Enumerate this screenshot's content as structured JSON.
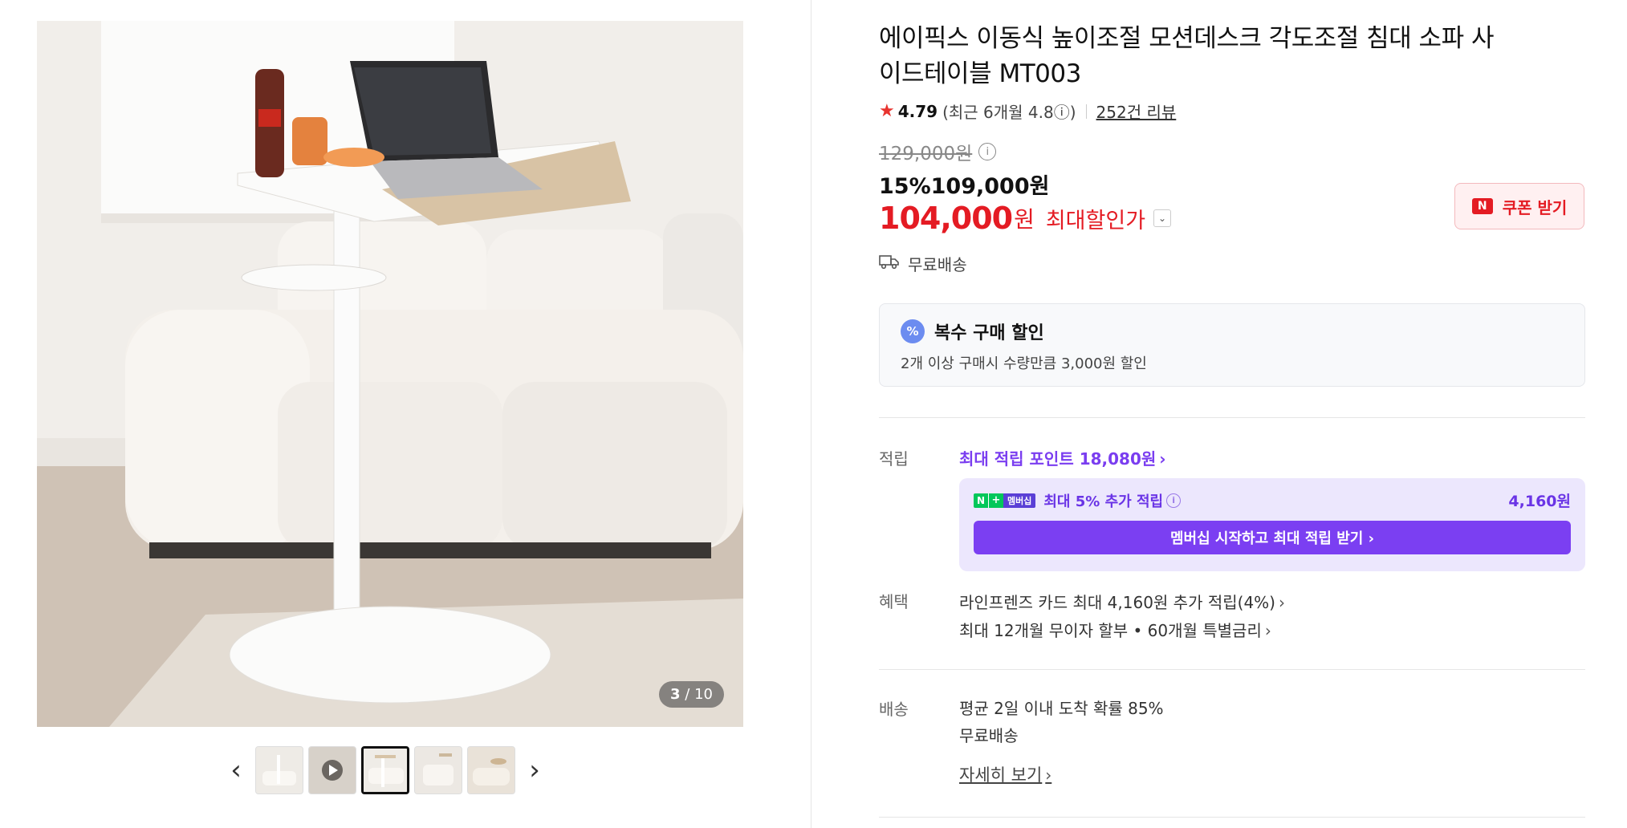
{
  "gallery": {
    "counter_current": "3",
    "counter_total": "/ 10",
    "prev_label": "‹",
    "next_label": "›"
  },
  "product": {
    "title": "에이픽스 이동식 높이조절 모션데스크 각도조절 침대 소파 사이드테이블 MT003",
    "rating": "4.79",
    "rating_recent": "(최근 6개월 4.8ⓘ)",
    "review_count": "252건 리뷰",
    "original_price": "129,000원",
    "sale_percent": "15%",
    "sale_price": "109,000원",
    "max_price": "104,000",
    "max_unit": "원",
    "max_label": "최대할인가",
    "coupon_label": "쿠폰 받기",
    "coupon_badge": "N",
    "shipping_free": "무료배송"
  },
  "multi_discount": {
    "title": "복수 구매 할인",
    "icon_text": "%",
    "desc": "2개 이상 구매시 수량만큼 3,000원 할인"
  },
  "points": {
    "label": "적립",
    "link": "최대 적립 포인트 18,080원",
    "member_badge_n": "N",
    "member_badge_plus": "+",
    "member_badge_text": "멤버십",
    "member_text": "최대 5% 추가 적립",
    "member_amount": "4,160원",
    "member_button": "멤버십 시작하고 최대 적립 받기 ›"
  },
  "benefits": {
    "label": "혜택",
    "line1": "라인프렌즈 카드 최대 4,160원 추가 적립(4%)",
    "line2": "최대 12개월 무이자 할부 • 60개월 특별금리"
  },
  "delivery": {
    "label": "배송",
    "line1": "평균 2일 이내 도착 확률 85%",
    "line2": "무료배송",
    "detail_link": "자세히 보기"
  },
  "colors": {
    "red": "#e41b23",
    "purple": "#7b3ff2",
    "purple_bg": "#ece7fd"
  }
}
